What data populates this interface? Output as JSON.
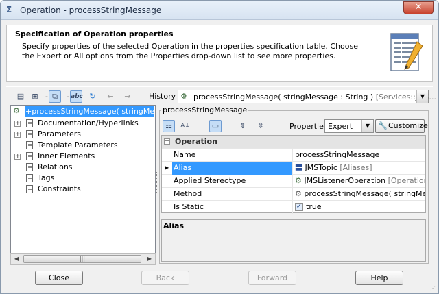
{
  "window": {
    "title": "Operation - processStringMessage",
    "close_label": "✕"
  },
  "header": {
    "title": "Specification of Operation properties",
    "description": "Specify properties of the selected Operation in the properties specification table. Choose the Expert or All options from the Properties drop-down list to see more properties."
  },
  "toolbar": {
    "history_label": "History :",
    "history_value": "processStringMessage( stringMessage : String )",
    "history_scope": "[Services::JMS..."
  },
  "tree": {
    "root_label": "+processStringMessage( stringMessage",
    "items": [
      {
        "label": "Documentation/Hyperlinks",
        "expandable": true
      },
      {
        "label": "Parameters",
        "expandable": true
      },
      {
        "label": "Template Parameters",
        "expandable": false
      },
      {
        "label": "Inner Elements",
        "expandable": true
      },
      {
        "label": "Relations",
        "expandable": false
      },
      {
        "label": "Tags",
        "expandable": false
      },
      {
        "label": "Constraints",
        "expandable": false
      }
    ]
  },
  "panel": {
    "title": "processStringMessage",
    "properties_label": "Properties:",
    "properties_value": "Expert",
    "customize_label": "Customize"
  },
  "grid": {
    "category": "Operation",
    "rows": [
      {
        "key": "Name",
        "value": "processStringMessage",
        "suffix": ""
      },
      {
        "key": "Alias",
        "value": "JMSTopic",
        "suffix": "[Aliases]"
      },
      {
        "key": "Applied Stereotype",
        "value": "JMSListenerOperation",
        "suffix": "[Operation] ["
      },
      {
        "key": "Method",
        "value": "processStringMessage( stringMessa",
        "suffix": ""
      },
      {
        "key": "Is Static",
        "value": "true",
        "suffix": ""
      }
    ]
  },
  "description_panel": {
    "title": "Alias"
  },
  "footer": {
    "close_label": "Close",
    "back_label": "Back",
    "forward_label": "Forward",
    "help_label": "Help"
  },
  "colors": {
    "selection": "#3399ff",
    "title_bar": "#d7e3f1",
    "close_button": "#c7402b"
  }
}
